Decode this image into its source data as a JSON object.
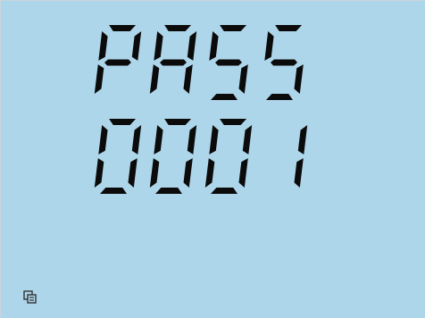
{
  "display": {
    "line1": "PASS",
    "line2": "0001"
  },
  "status": {
    "icon": "communication-icon"
  },
  "colors": {
    "lcd_background": "#aed6ea",
    "segment": "#0b0b0b"
  }
}
